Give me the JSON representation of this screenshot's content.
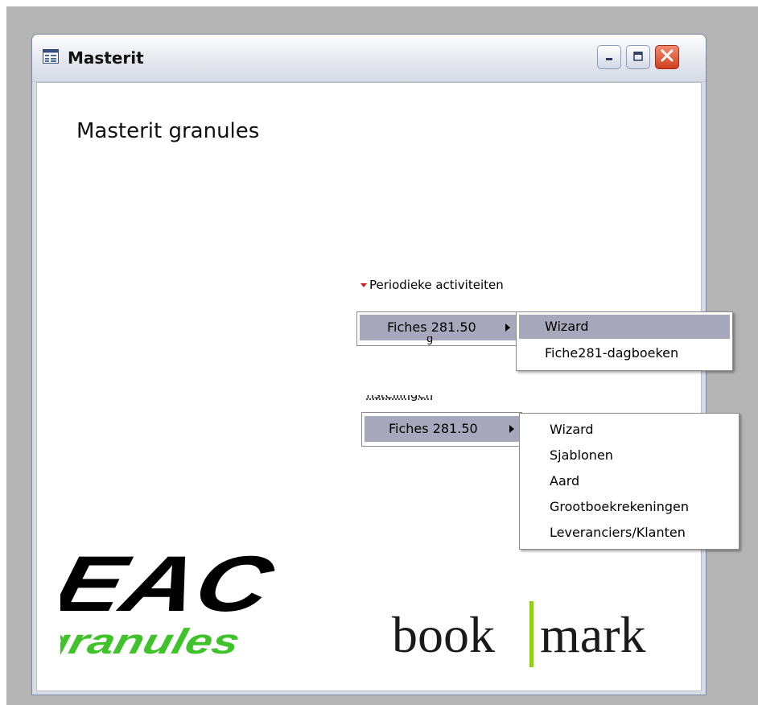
{
  "window": {
    "title": "Masterit"
  },
  "app": {
    "heading": "Masterit granules"
  },
  "periodic": {
    "section_title": "Periodieke activiteiten",
    "partial_text": "g",
    "parent_item": "Fiches 281.50",
    "submenu": [
      "Wizard",
      "Fiche281-dagboeken"
    ],
    "selected": "Wizard"
  },
  "settings": {
    "section_title": "Instellingen",
    "parent_item": "Fiches 281.50",
    "submenu": [
      "Wizard",
      "Sjablonen",
      "Aard",
      "Grootboekrekeningen",
      "Leveranciers/Klanten"
    ]
  },
  "logos": {
    "eac_text": "EAC",
    "granules_text": "granules",
    "bookmark_left": "book",
    "bookmark_right": "mark"
  },
  "colors": {
    "selection": "#a8a8bc",
    "granules_green": "#3fc22a",
    "bookmark_bar": "#8fd400",
    "section_triangle": "#d02020"
  }
}
